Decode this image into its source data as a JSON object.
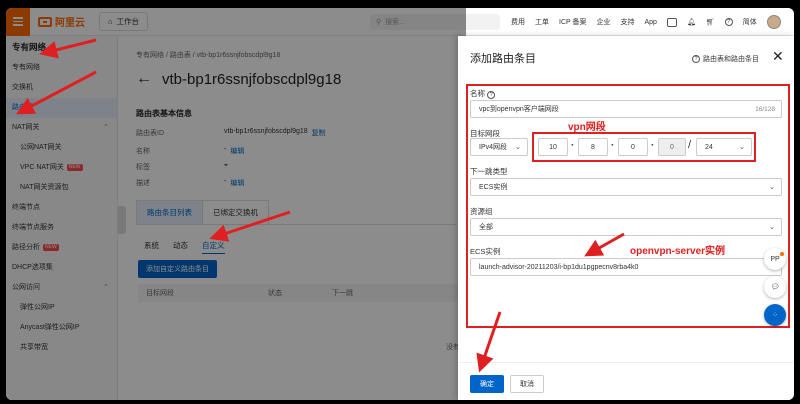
{
  "topbar": {
    "logo_text": "阿里云",
    "workbench": "工作台",
    "search_placeholder": "搜索...",
    "links": [
      "费用",
      "工单",
      "ICP 备案",
      "企业",
      "支持",
      "App"
    ],
    "lang": "简体"
  },
  "sidebar": {
    "header": "专有网络",
    "items": [
      {
        "label": "专有网络",
        "sub": false
      },
      {
        "label": "交换机",
        "sub": false
      },
      {
        "label": "路由表",
        "sub": false,
        "active": true
      },
      {
        "label": "NAT网关",
        "sub": false,
        "chevron": true
      },
      {
        "label": "公网NAT网关",
        "sub": true
      },
      {
        "label": "VPC NAT网关",
        "sub": true,
        "badge": "NEW"
      },
      {
        "label": "NAT网关资源包",
        "sub": true
      },
      {
        "label": "终端节点",
        "sub": false
      },
      {
        "label": "终端节点服务",
        "sub": false
      },
      {
        "label": "路径分析",
        "sub": false,
        "badge": "NEW"
      },
      {
        "label": "DHCP选项集",
        "sub": false
      },
      {
        "label": "公网访问",
        "sub": false,
        "chevron": true
      },
      {
        "label": "弹性公网IP",
        "sub": true
      },
      {
        "label": "Anycast弹性公网IP",
        "sub": true
      },
      {
        "label": "共享带宽",
        "sub": true
      }
    ]
  },
  "main": {
    "breadcrumb": "专有网络  /  路由表  /  vtb-bp1r6ssnjfobscdpl9g18",
    "title": "vtb-bp1r6ssnjfobscdpl9g18",
    "section_title": "路由表基本信息",
    "info": {
      "id_label": "路由表ID",
      "id_value": "vtb-bp1r6ssnjfobscdpl9g18",
      "copy": "复制",
      "name_label": "名称",
      "name_value": "-",
      "tag_label": "标签",
      "desc_label": "描述",
      "desc_value": "-",
      "edit": "编辑"
    },
    "tabs": [
      "路由条目列表",
      "已绑定交换机"
    ],
    "subtabs": [
      "系统",
      "动态",
      "自定义"
    ],
    "add_button": "添加自定义路由条目",
    "table_headers": [
      "目标网段",
      "状态",
      "下一跳"
    ],
    "no_data": "没有"
  },
  "drawer": {
    "title": "添加路由条目",
    "help": "路由表和路由条目",
    "name_label": "名称",
    "name_value": "vpc到openvpn客户端网段",
    "name_counter": "16/128",
    "target_label": "目标网段",
    "ip_type": "IPv4网段",
    "octets": [
      "10",
      "8",
      "0",
      "0"
    ],
    "prefix": "24",
    "next_hop_label": "下一跳类型",
    "next_hop_value": "ECS实例",
    "resource_group_label": "资源组",
    "resource_group_value": "全部",
    "ecs_label": "ECS实例",
    "ecs_value": "launch-advisor-20211203/i-bp1du1pgpecnv8rba4k0",
    "ok": "确定",
    "cancel": "取消"
  },
  "annotations": {
    "vpn": "vpn网段",
    "instance": "openvpn-server实例"
  },
  "float_buttons": [
    "PP",
    "chat-icon",
    "apps-icon"
  ],
  "colors": {
    "brand": "#ff6a00",
    "primary": "#0064c8",
    "annotation": "#e02020"
  }
}
